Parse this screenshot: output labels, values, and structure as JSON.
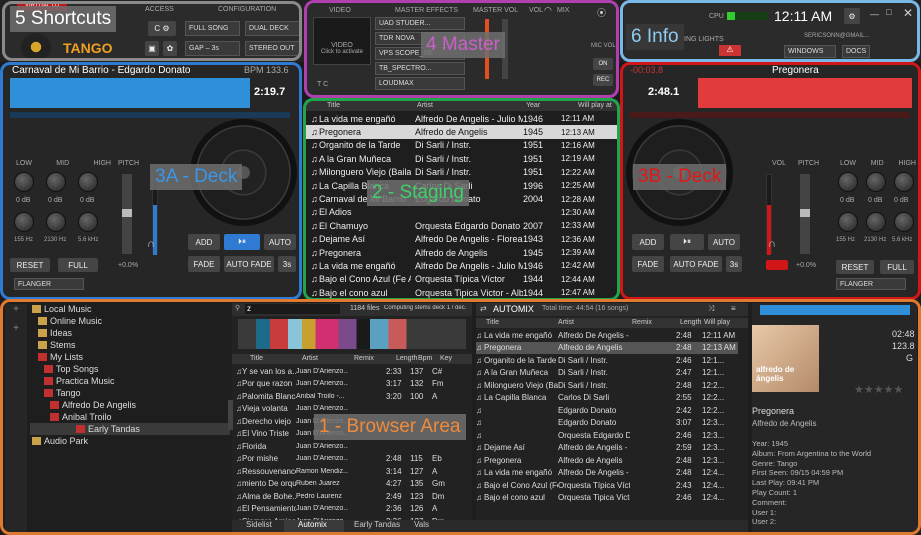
{
  "topbar": {
    "shortcuts": {
      "access": "ACCESS",
      "configuration": "CONFIGURATION",
      "full_song": "FULL SONG",
      "dual_deck": "DUAL DECK",
      "gap": "GAP – 3s",
      "stereo_out": "STEREO OUT",
      "tango": "TANGO",
      "brand": "VIRTUAL DJ"
    },
    "master": {
      "video": "VIDEO",
      "video_box": "VIDEO",
      "video_hint": "Click to activate",
      "master_effects": "MASTER EFFECTS",
      "master_vol": "MASTER VOL",
      "vol": "VOL",
      "mix": "MIX",
      "effects": [
        "UAD STUDER...",
        "TDR NOVA",
        "VPS SCOPE_XE",
        "TB_SPECTRO...",
        "LOUDMAX"
      ],
      "mic_vol": "MIC VOL",
      "on": "ON",
      "rec": "REC",
      "tc": "T C"
    },
    "info": {
      "cpu": "CPU",
      "clock": "12:11 AM",
      "lights": "ING LIGHTS",
      "email": "SERICSONN@GMAIL...",
      "windows": "WINDOWS",
      "docs": "DOCS"
    }
  },
  "deck_a": {
    "title": "Carnaval de Mi Barrio",
    "artist": "Edgardo Donato",
    "bpm": "BPM  133.6",
    "time": "2:19.7",
    "eq": [
      "LOW",
      "MID",
      "HIGH"
    ],
    "pitch": "PITCH",
    "db": [
      "0 dB",
      "0 dB",
      "0 dB"
    ],
    "freqs": [
      "155 Hz",
      "2130 Hz",
      "5.6 kHz"
    ],
    "reset": "RESET",
    "full": "FULL",
    "pitch_val": "+0.0%",
    "add": "ADD",
    "auto": "AUTO",
    "fade": "FADE",
    "auto_fade": "AUTO FADE",
    "secs": "3s",
    "effect": "FLANGER"
  },
  "deck_b": {
    "title": "Pregonera",
    "time_left": "-00:03.8",
    "time": "2:48.1",
    "vol": "VOL",
    "pitch": "PITCH",
    "eq": [
      "LOW",
      "MID",
      "HIGH"
    ],
    "db": [
      "0 dB",
      "0 dB",
      "0 dB"
    ],
    "freqs": [
      "155 Hz",
      "2130 Hz",
      "5.6 kHz"
    ],
    "reset": "RESET",
    "full": "FULL",
    "pitch_val": "+0.0%",
    "add": "ADD",
    "auto": "AUTO",
    "fade": "FADE",
    "auto_fade": "AUTO FADE",
    "secs": "3s",
    "effect": "FLANGER"
  },
  "staging": {
    "headers": [
      "Title",
      "Artist",
      "Year",
      "Will play at"
    ],
    "rows": [
      [
        "La vida me engañó",
        "Alfredo De Angelis - Julio Martel",
        "1946",
        "12:11 AM"
      ],
      [
        "Pregonera",
        "Alfredo de Angelis",
        "1945",
        "12:13 AM"
      ],
      [
        "Organito de la Tarde",
        "Di Sarli / Instr.",
        "1951",
        "12:16 AM"
      ],
      [
        "A la Gran Muñeca",
        "Di Sarli / Instr.",
        "1951",
        "12:19 AM"
      ],
      [
        "Milonguero Viejo (Bailarin P...",
        "Di Sarli / Instr.",
        "1951",
        "12:22 AM"
      ],
      [
        "La Capilla Blanca",
        "Carlos Di Sarli",
        "1996",
        "12:25 AM"
      ],
      [
        "Carnaval de Mi Barrio",
        "Edgardo Donato",
        "2004",
        "12:28 AM"
      ],
      [
        "El Adios",
        "",
        "",
        "12:30 AM"
      ],
      [
        "El Chamuyo",
        "Orquesta Edgardo Donato",
        "2007",
        "12:33 AM"
      ],
      [
        "Dejame Así",
        "Alfredo De Angelis - Floreal Ruiz",
        "1943",
        "12:36 AM"
      ],
      [
        "Pregonera",
        "Alfredo de Angelis",
        "1945",
        "12:39 AM"
      ],
      [
        "La vida me engañó",
        "Alfredo De Angelis - Julio Martel",
        "1946",
        "12:42 AM"
      ],
      [
        "Bajo el Cono Azul (Fe Alb...",
        "Orquesta Típica Víctor",
        "1944",
        "12:44 AM"
      ],
      [
        "Bajo el cono azul",
        "Orquesta Tipica Victor - Alberto Carol",
        "1944",
        "12:47 AM"
      ]
    ]
  },
  "browser": {
    "tree": [
      "Local Music",
      "Online Music",
      "Ideas",
      "Stems",
      "My Lists",
      "Top Songs",
      "Practica Music",
      "Tango",
      "Alfredo De Angelis",
      "Anibal Troilo",
      "Early Tandas",
      "Audio Park"
    ],
    "search": "z",
    "files": "1184 files",
    "computing": "Computing stems deck 1 / dec...",
    "headers": [
      "Title",
      "Artist",
      "Remix",
      "Length",
      "Bpm",
      "Key"
    ],
    "rows": [
      [
        "Y se van los a...",
        "Juan D'Arienzo...",
        "",
        "2:33",
        "137",
        "C#"
      ],
      [
        "Por que razon",
        "Juan D'Arienzo...",
        "",
        "3:17",
        "132",
        "Fm"
      ],
      [
        "Palomita Blanca",
        "Anibal Troilo -...",
        "",
        "3:20",
        "100",
        "A"
      ],
      [
        "Vieja volanta",
        "Juan D'Arienzo...",
        "",
        "",
        "",
        ""
      ],
      [
        "Derecho viejo",
        "Juan D'Arienzo...",
        "",
        "",
        "",
        ""
      ],
      [
        "El Vino Triste",
        "Juan D'Arienzo...",
        "",
        "",
        "",
        ""
      ],
      [
        "Florida",
        "Juan D'Arienzo...",
        "",
        "",
        "",
        ""
      ],
      [
        "Por mishe",
        "Juan D'Arienzo...",
        "",
        "2:48",
        "115",
        "Eb"
      ],
      [
        "Ressouvenance",
        "Ramon Mendiz...",
        "",
        "3:14",
        "127",
        "A"
      ],
      [
        "miento De orques",
        "Ruben Juarez",
        "",
        "4:27",
        "135",
        "Gm"
      ],
      [
        "Alma de Bohe...",
        "Pedro Laurenz",
        "",
        "2:49",
        "123",
        "Dm"
      ],
      [
        "El Pensamiento",
        "Juan D'Arienzo...",
        "",
        "2:36",
        "126",
        "A"
      ],
      [
        "Siempre Amigos",
        "Juan D'Arienzo...",
        "",
        "2:36",
        "127",
        "Dm"
      ]
    ],
    "sidelist": "Sidelist"
  },
  "automix": {
    "title": "AUTOMIX",
    "total": "Total time: 44:54 (16 songs)",
    "headers": [
      "Title",
      "Artist",
      "Remix",
      "Length",
      "Will play"
    ],
    "rows": [
      [
        "La vida me engañó",
        "Alfredo De Angelis - J...",
        "",
        "2:48",
        "12:11 AM"
      ],
      [
        "Pregonera",
        "Alfredo de Angelis",
        "",
        "2:48",
        "12:13 AM"
      ],
      [
        "Organito de la Tarde",
        "Di Sarli / Instr.",
        "",
        "2:46",
        "12:1..."
      ],
      [
        "A la Gran Muñeca",
        "Di Sarli / Instr.",
        "",
        "2:47",
        "12:1..."
      ],
      [
        "Milonguero Viejo (Bail...",
        "Di Sarli / Instr.",
        "",
        "2:48",
        "12:2..."
      ],
      [
        "La Capilla Blanca",
        "Carlos Di Sarli",
        "",
        "2:55",
        "12:2..."
      ],
      [
        "",
        "Edgardo Donato",
        "",
        "2:42",
        "12:2..."
      ],
      [
        "",
        "Edgardo Donato",
        "",
        "3:07",
        "12:3..."
      ],
      [
        "",
        "Orquesta Edgardo Do...",
        "",
        "2:46",
        "12:3..."
      ],
      [
        "Dejame Así",
        "Alfredo de Angelis - F...",
        "",
        "2:59",
        "12:3..."
      ],
      [
        "Pregonera",
        "Alfredo de Angelis",
        "",
        "2:48",
        "12:3..."
      ],
      [
        "La vida me engañó",
        "Alfredo De Angelis - J...",
        "",
        "2:48",
        "12:4..."
      ],
      [
        "Bajo el Cono Azul (Fe...",
        "Orquesta Típica Víctor",
        "",
        "2:43",
        "12:4..."
      ],
      [
        "Bajo el cono azul",
        "Orquesta Tipica Victo...",
        "",
        "2:46",
        "12:4..."
      ]
    ],
    "tabs": [
      "Sidelist",
      "Automix",
      "Early Tandas",
      "Vals"
    ]
  },
  "info_panel": {
    "length": "02:48",
    "bpm": "123.8",
    "key": "G",
    "album_art_text": "alfredo de ángelis",
    "title": "Pregonera",
    "artist": "Alfredo de Angelis",
    "fields": [
      "Year: 1945",
      "Album: From Argentina to the World",
      "Genre: Tango",
      "First Seen: 09/15 04:59 PM",
      "Last Play: 09:41 PM",
      "Play Count: 1",
      "Comment:",
      "User 1:",
      "User 2:"
    ]
  },
  "overlays": {
    "shortcuts": "5 Shortcuts",
    "master": "4 Master",
    "info": "6 Info",
    "deck_a": "3A - Deck",
    "staging": "2 - Staging",
    "deck_b": "3B - Deck",
    "browser": "1 - Browser Area"
  },
  "colors": {
    "deck_a_wave": "#2f8fd8",
    "deck_b_wave": "#e23b3b",
    "staging_border": "#1fa64a",
    "browser_border": "#e07a30",
    "deck_a_border": "#2f7ad3",
    "deck_b_border": "#d01616",
    "master_border": "#b03fb0",
    "info_border": "#7ab8e8"
  }
}
